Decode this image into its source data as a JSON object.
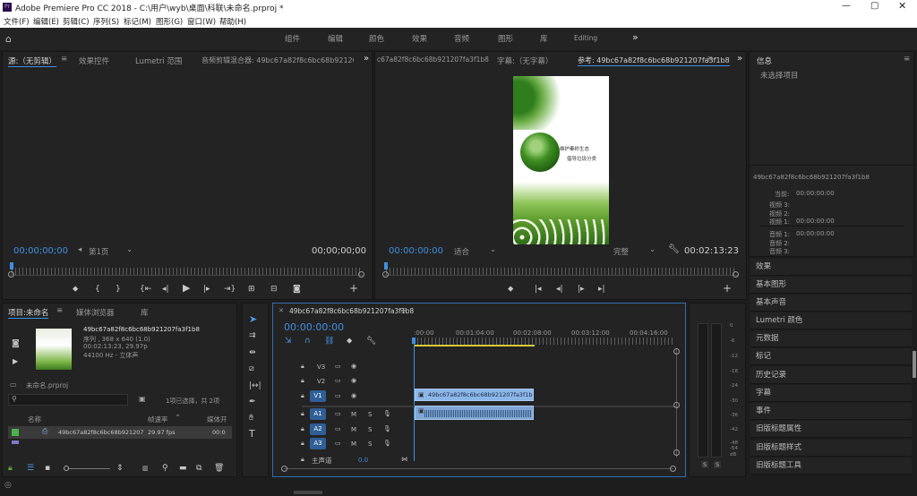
{
  "titlebar": {
    "title": "Adobe Premiere Pro CC 2018 - C:\\用户\\wyb\\桌面\\科联\\未命名.prproj *"
  },
  "menu": [
    "文件(F)",
    "编辑(E)",
    "剪辑(C)",
    "序列(S)",
    "标记(M)",
    "图形(G)",
    "窗口(W)",
    "帮助(H)"
  ],
  "workspaces": [
    "组件",
    "编辑",
    "颜色",
    "效果",
    "音频",
    "图形",
    "库",
    "Editing"
  ],
  "source_panel": {
    "tabs": [
      "源:（无剪辑）",
      "效果控件",
      "Lumetri 范围",
      "音频剪辑混合器: 49bc67a82f8c6bc68b921207f"
    ],
    "timecode_in": "00;00;00;00",
    "page": "第1页",
    "timecode_out": "00;00;00;00"
  },
  "program_panel": {
    "tabs": [
      "c67a82f8c6bc68b921207fa3f1b8",
      "字幕:（无字幕）",
      "参考: 49bc67a82f8c6bc68b921207fa3f1b8"
    ],
    "timecode": "00:00:00:00",
    "fit": "适合",
    "quality": "完整",
    "duration": "00:02:13:23"
  },
  "video_frame": {
    "line1": "维护秦岭生态",
    "line2": "倡导垃圾分类"
  },
  "info_panel": {
    "title": "信息",
    "no_selection": "未选择项目",
    "clip_name": "49bc67a82f8c6bc68b921207fa3f1b8",
    "current_label": "当前:",
    "current_val": "00:00:00:00",
    "rows": [
      {
        "label": "视频 3:",
        "val": ""
      },
      {
        "label": "视频 2:",
        "val": ""
      },
      {
        "label": "视频 1:",
        "val": "00:00:00:00"
      },
      {
        "label": "音频 1:",
        "val": "00:00:00:00"
      },
      {
        "label": "音频 2:",
        "val": ""
      },
      {
        "label": "音频 3:",
        "val": ""
      }
    ]
  },
  "right_panels": [
    "效果",
    "基本图形",
    "基本声音",
    "Lumetri 颜色",
    "元数据",
    "标记",
    "历史记录",
    "字幕",
    "事件",
    "旧版标题属性",
    "旧版标题样式",
    "旧版标题工具"
  ],
  "project_panel": {
    "tabs": [
      "项目:未命名",
      "媒体浏览器",
      "库"
    ],
    "clip_name": "49bc67a82f8c6bc68b921207fa3f1b8",
    "clip_seq": "序列 , 368 x 640 (1.0)",
    "clip_dur": "00:02:13:23, 29.97p",
    "clip_audio": "44100 Hz - 立体声",
    "project_file": "未命名.prproj",
    "selection": "1项已选择，共 2项",
    "col_name": "名称",
    "col_rate": "帧速率",
    "col_media": "媒体开",
    "item_name": "49bc67a82f8c6bc68b921207",
    "item_rate": "29.97 fps",
    "item_start": "00:0"
  },
  "timeline": {
    "tab": "49bc67a82f8c6bc68b921207fa3f1b8",
    "timecode": "00:00:00:00",
    "ruler": [
      ":00:00",
      "00:01:04:00",
      "00:02:08:00",
      "00:03:12:00",
      "00:04:16:00"
    ],
    "tracks": [
      "V3",
      "V2",
      "V1",
      "A1",
      "A2",
      "A3"
    ],
    "master": "主声道",
    "master_val": "0.0",
    "video_clip": "49bc67a82f8c6bc68b921207fa3f1b8.mp4 [V]"
  },
  "meter": {
    "ticks": [
      "0",
      "-6",
      "-12",
      "-18",
      "-24",
      "-30",
      "-36",
      "-42",
      "-48",
      "-54",
      "dB"
    ],
    "solo": [
      "S",
      "S"
    ]
  }
}
